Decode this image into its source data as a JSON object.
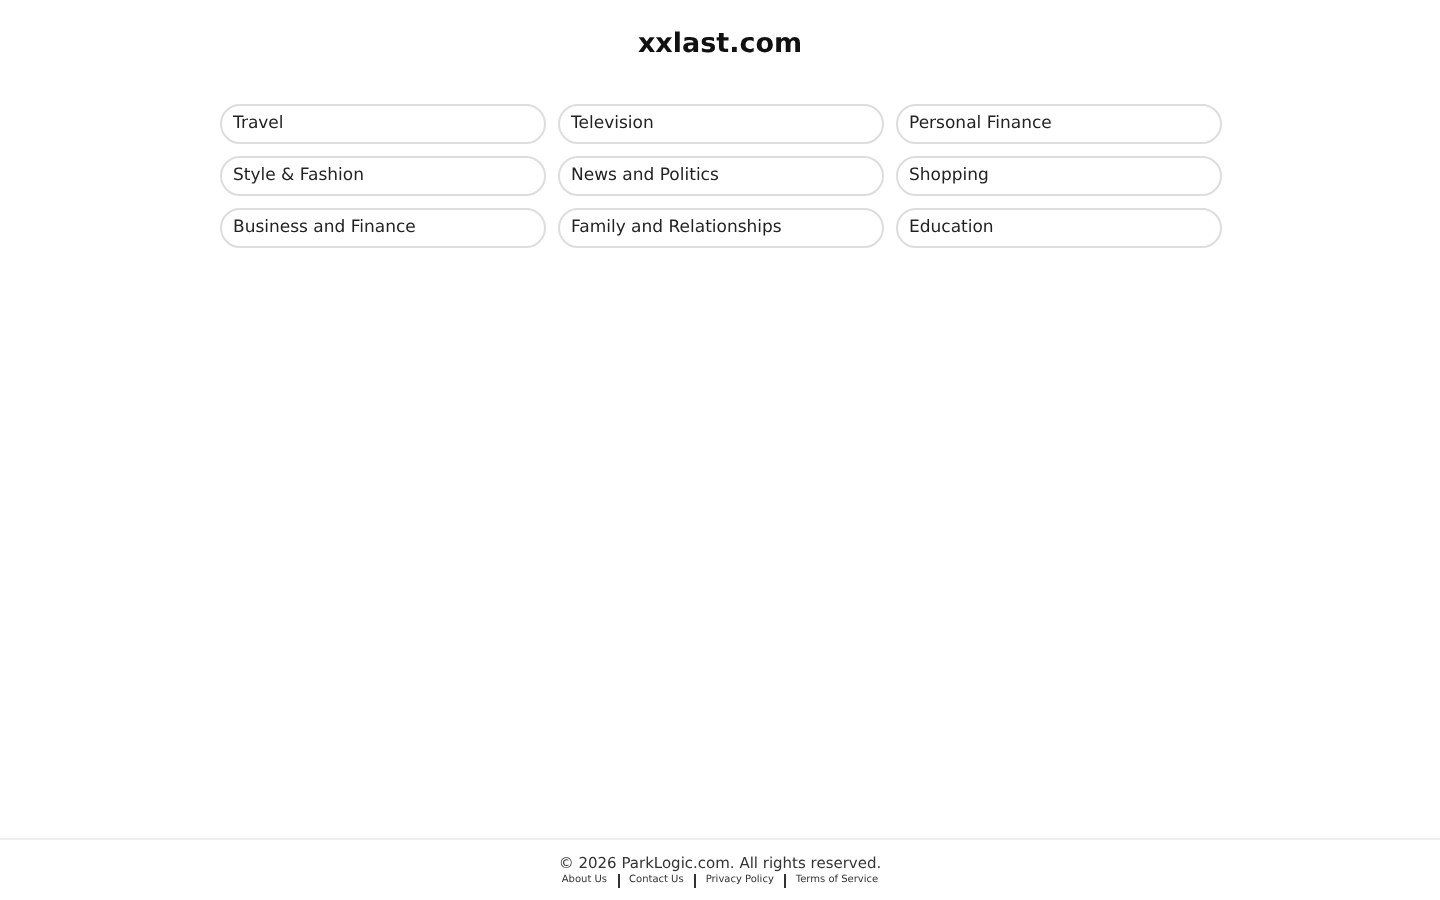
{
  "site_title": "xxlast.com",
  "links": [
    "Travel",
    "Television",
    "Personal Finance",
    "Style & Fashion",
    "News and Politics",
    "Shopping",
    "Business and Finance",
    "Family and Relationships",
    "Education"
  ],
  "footer": {
    "copyright": "© 2026 ParkLogic.com. All rights reserved.",
    "links": [
      "About Us",
      "Contact Us",
      "Privacy Policy",
      "Terms of Service"
    ]
  }
}
